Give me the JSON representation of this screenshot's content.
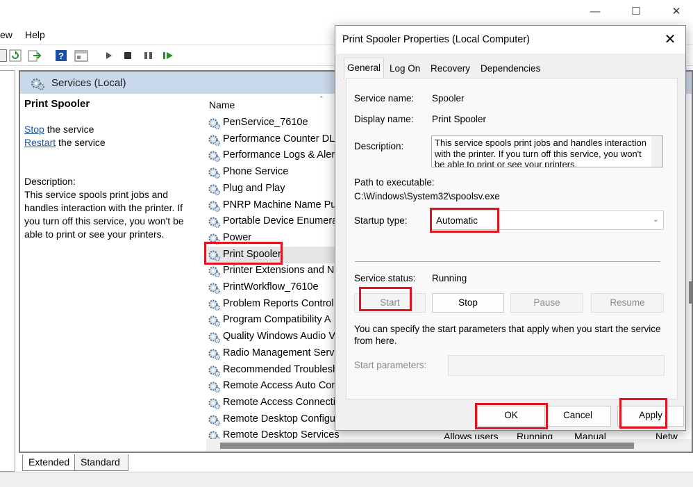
{
  "window": {
    "caption": {
      "minimize": "—",
      "maximize": "☐",
      "close": "✕"
    }
  },
  "menu": {
    "view_partial": "ew",
    "help": "Help"
  },
  "pane": {
    "header_title": "Services (Local)",
    "selected_service_title": "Print Spooler",
    "stop_link": "Stop",
    "stop_suffix": " the service",
    "restart_link": "Restart",
    "restart_suffix": " the service",
    "description_label": "Description:",
    "description_text": "This service spools print jobs and handles interaction with the printer. If you turn off this service, you won't be able to print or see your printers.",
    "column_name": "Name",
    "services": [
      "PenService_7610e",
      "Performance Counter DLL",
      "Performance Logs & Alerts",
      "Phone Service",
      "Plug and Play",
      "PNRP Machine Name Pub",
      "Portable Device Enumera",
      "Power",
      "Print Spooler",
      "Printer Extensions and N",
      "PrintWorkflow_7610e",
      "Problem Reports Control",
      "Program Compatibility A",
      "Quality Windows Audio V",
      "Radio Management Serv",
      "Recommended Troublesh",
      "Remote Access Auto Con",
      "Remote Access Connectio",
      "Remote Desktop Configu",
      "Remote Desktop Services"
    ],
    "last_row_extra": {
      "description": "Allows users",
      "status": "Running",
      "startup": "Manual",
      "logon": "Netw"
    }
  },
  "bottom_tabs": {
    "extended": "Extended",
    "standard": "Standard"
  },
  "dialog": {
    "title": "Print Spooler Properties (Local Computer)",
    "close_glyph": "✕",
    "tabs": [
      "General",
      "Log On",
      "Recovery",
      "Dependencies"
    ],
    "service_name_label": "Service name:",
    "service_name_value": "Spooler",
    "display_name_label": "Display name:",
    "display_name_value": "Print Spooler",
    "description_label": "Description:",
    "description_value": "This service spools print jobs and handles interaction with the printer.  If you turn off this service, you won't be able to print or see your printers.",
    "path_label": "Path to executable:",
    "path_value": "C:\\Windows\\System32\\spoolsv.exe",
    "startup_type_label": "Startup type:",
    "startup_type_value": "Automatic",
    "service_status_label": "Service status:",
    "service_status_value": "Running",
    "buttons": {
      "start": "Start",
      "stop": "Stop",
      "pause": "Pause",
      "resume": "Resume"
    },
    "hint": "You can specify the start parameters that apply when you start the service from here.",
    "start_params_label": "Start parameters:",
    "footer": {
      "ok": "OK",
      "cancel": "Cancel",
      "apply": "Apply"
    }
  },
  "colors": {
    "highlight": "#e0141e",
    "pane_header": "#c9d8ea",
    "link": "#1a4fa8"
  }
}
